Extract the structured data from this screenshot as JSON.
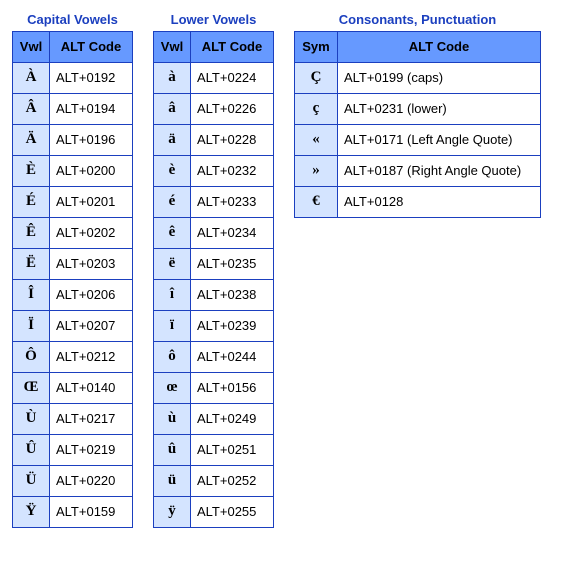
{
  "capital": {
    "title": "Capital Vowels",
    "head_sym": "Vwl",
    "head_code": "ALT Code",
    "rows": [
      {
        "sym": "À",
        "code": "ALT+0192"
      },
      {
        "sym": "Â",
        "code": "ALT+0194"
      },
      {
        "sym": "Ä",
        "code": "ALT+0196"
      },
      {
        "sym": "È",
        "code": "ALT+0200"
      },
      {
        "sym": "É",
        "code": "ALT+0201"
      },
      {
        "sym": "Ê",
        "code": "ALT+0202"
      },
      {
        "sym": "Ë",
        "code": "ALT+0203"
      },
      {
        "sym": "Î",
        "code": "ALT+0206"
      },
      {
        "sym": "Ï",
        "code": "ALT+0207"
      },
      {
        "sym": "Ô",
        "code": "ALT+0212"
      },
      {
        "sym": "Œ",
        "code": "ALT+0140"
      },
      {
        "sym": "Ù",
        "code": "ALT+0217"
      },
      {
        "sym": "Û",
        "code": "ALT+0219"
      },
      {
        "sym": "Ü",
        "code": "ALT+0220"
      },
      {
        "sym": "Ÿ",
        "code": "ALT+0159"
      }
    ]
  },
  "lower": {
    "title": "Lower Vowels",
    "head_sym": "Vwl",
    "head_code": "ALT Code",
    "rows": [
      {
        "sym": "à",
        "code": "ALT+0224"
      },
      {
        "sym": "â",
        "code": "ALT+0226"
      },
      {
        "sym": "ä",
        "code": "ALT+0228"
      },
      {
        "sym": "è",
        "code": "ALT+0232"
      },
      {
        "sym": "é",
        "code": "ALT+0233"
      },
      {
        "sym": "ê",
        "code": "ALT+0234"
      },
      {
        "sym": "ë",
        "code": "ALT+0235"
      },
      {
        "sym": "î",
        "code": "ALT+0238"
      },
      {
        "sym": "ï",
        "code": "ALT+0239"
      },
      {
        "sym": "ô",
        "code": "ALT+0244"
      },
      {
        "sym": "œ",
        "code": "ALT+0156"
      },
      {
        "sym": "ù",
        "code": "ALT+0249"
      },
      {
        "sym": "û",
        "code": "ALT+0251"
      },
      {
        "sym": "ü",
        "code": "ALT+0252"
      },
      {
        "sym": "ÿ",
        "code": "ALT+0255"
      }
    ]
  },
  "cons": {
    "title": "Consonants, Punctuation",
    "head_sym": "Sym",
    "head_code": "ALT Code",
    "rows": [
      {
        "sym": "Ç",
        "code": "ALT+0199 (caps)"
      },
      {
        "sym": "ç",
        "code": "ALT+0231 (lower)"
      },
      {
        "sym": "«",
        "code": "ALT+0171 (Left Angle Quote)"
      },
      {
        "sym": "»",
        "code": "ALT+0187 (Right Angle Quote)"
      },
      {
        "sym": "€",
        "code": "ALT+0128"
      }
    ]
  }
}
